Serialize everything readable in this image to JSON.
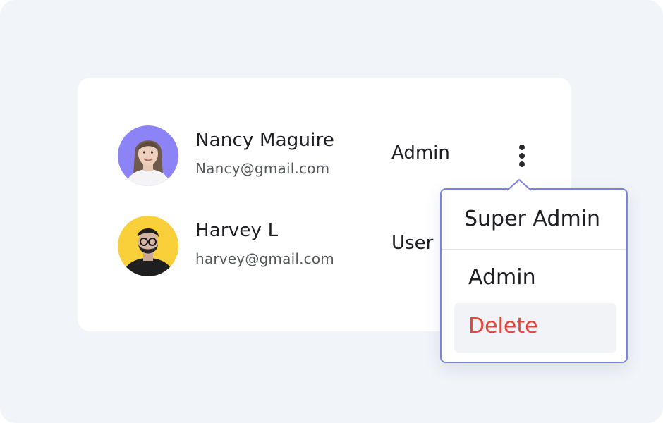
{
  "users": [
    {
      "name": "Nancy Maguire",
      "email": "Nancy@gmail.com",
      "role": "Admin",
      "avatar_bg": "#8c84f6"
    },
    {
      "name": "Harvey L",
      "email": "harvey@gmail.com",
      "role": "User",
      "avatar_bg": "#f9cf3a"
    }
  ],
  "role_menu": {
    "items": [
      "Super Admin",
      "Admin",
      "Delete"
    ],
    "highlighted_item": "Delete"
  },
  "icons": {
    "more_options": "more-vertical-icon"
  },
  "colors": {
    "background": "#f1f4f8",
    "card": "#ffffff",
    "menu_border": "#7b84dc",
    "delete_text": "#e5463a",
    "delete_highlight": "#f1f3f6"
  }
}
